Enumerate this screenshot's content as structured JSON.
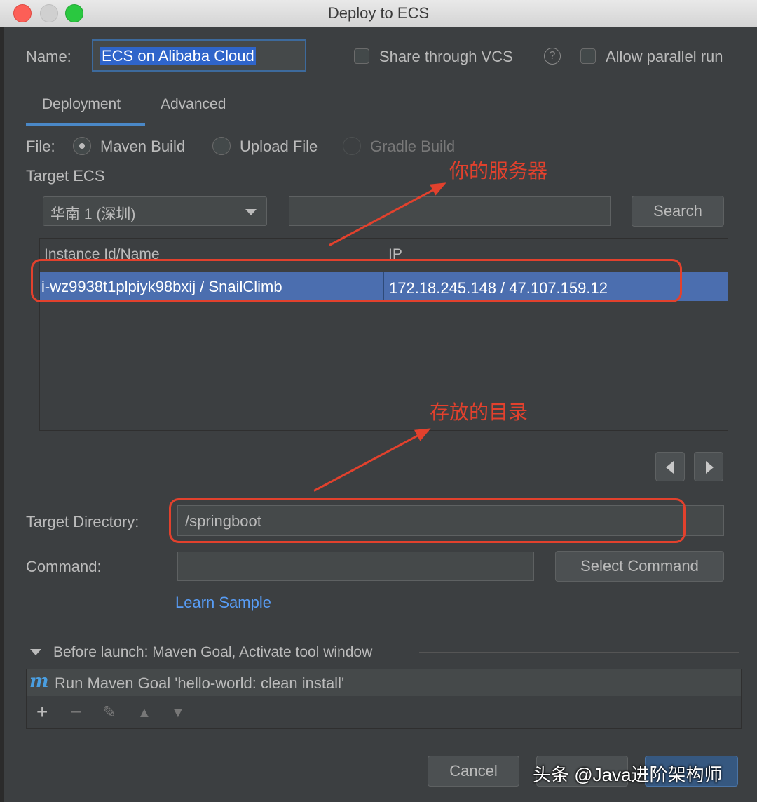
{
  "window": {
    "title": "Deploy to ECS"
  },
  "name_field": {
    "label": "Name:",
    "value": "ECS on Alibaba Cloud"
  },
  "options": {
    "share_vcs": "Share through VCS",
    "help_icon": "?",
    "allow_parallel": "Allow parallel run"
  },
  "tabs": [
    {
      "label": "Deployment",
      "active": true
    },
    {
      "label": "Advanced",
      "active": false
    }
  ],
  "file": {
    "label": "File:",
    "options": [
      {
        "label": "Maven Build",
        "selected": true,
        "enabled": true
      },
      {
        "label": "Upload File",
        "selected": false,
        "enabled": true
      },
      {
        "label": "Gradle Build",
        "selected": false,
        "enabled": false
      }
    ]
  },
  "target_ecs": {
    "label": "Target ECS",
    "region": "华南 1 (深圳)",
    "search_value": "",
    "search_button": "Search",
    "columns": [
      "Instance Id/Name",
      "IP"
    ],
    "rows": [
      {
        "instance": "i-wz9938t1plpiyk98bxij / SnailClimb",
        "ip": "172.18.245.148 / 47.107.159.12"
      }
    ]
  },
  "target_directory": {
    "label": "Target Directory:",
    "value": "/springboot"
  },
  "command": {
    "label": "Command:",
    "value": "",
    "button": "Select Command"
  },
  "learn_sample": "Learn Sample",
  "before_launch": {
    "label": "Before launch: Maven Goal, Activate tool window",
    "icon_letter": "m",
    "item": "Run Maven Goal 'hello-world: clean install'",
    "tools": {
      "add": "+",
      "remove": "−",
      "edit": "✎",
      "up": "▲",
      "down": "▼"
    }
  },
  "footer": {
    "cancel": "Cancel"
  },
  "annotations": {
    "server": "你的服务器",
    "directory": "存放的目录"
  },
  "watermark": "头条 @Java进阶架构师",
  "colors": {
    "background": "#3c3f41",
    "selection": "#4b6eaf",
    "annotation": "#e2412d",
    "link": "#589df6"
  }
}
